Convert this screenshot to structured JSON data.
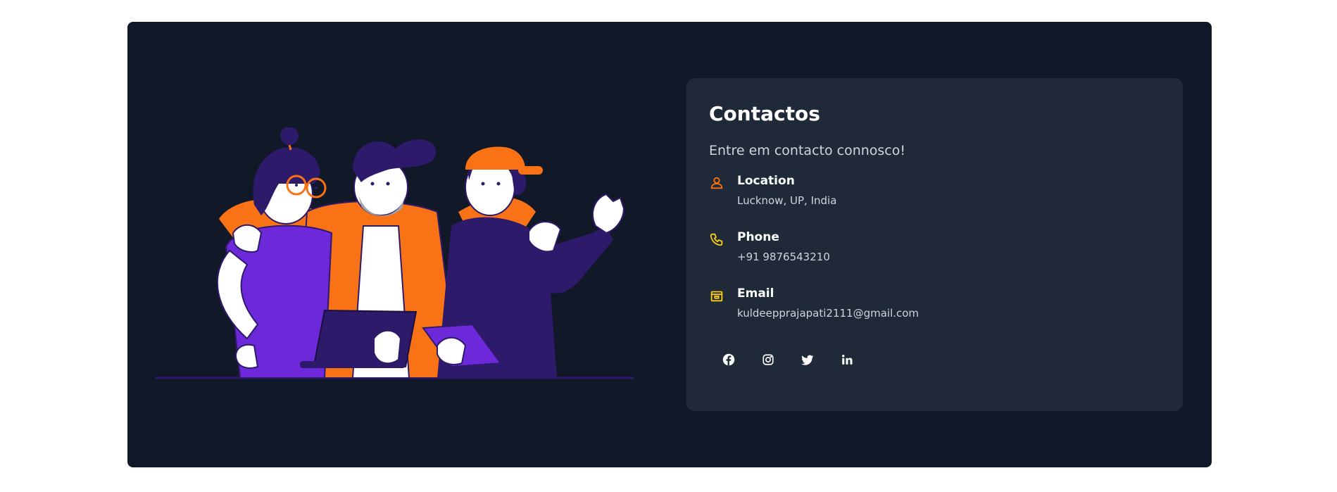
{
  "contact": {
    "title": "Contactos",
    "subtitle": "Entre em contacto connosco!",
    "items": [
      {
        "icon": "person-icon",
        "label": "Location",
        "value": "Lucknow, UP, India"
      },
      {
        "icon": "phone-icon",
        "label": "Phone",
        "value": "+91 9876543210"
      },
      {
        "icon": "mailbox-icon",
        "label": "Email",
        "value": "kuldeepprajapati2111@gmail.com"
      }
    ],
    "social": [
      {
        "icon": "facebook-icon"
      },
      {
        "icon": "instagram-icon"
      },
      {
        "icon": "twitter-icon"
      },
      {
        "icon": "linkedin-icon"
      }
    ]
  },
  "colors": {
    "page_bg": "#ffffff",
    "panel_bg": "#111827",
    "card_bg": "#1f2937",
    "accent_orange": "#f97316",
    "accent_yellow": "#facc15",
    "purple": "#6d28d9",
    "dark_purple": "#2e1a6b"
  }
}
